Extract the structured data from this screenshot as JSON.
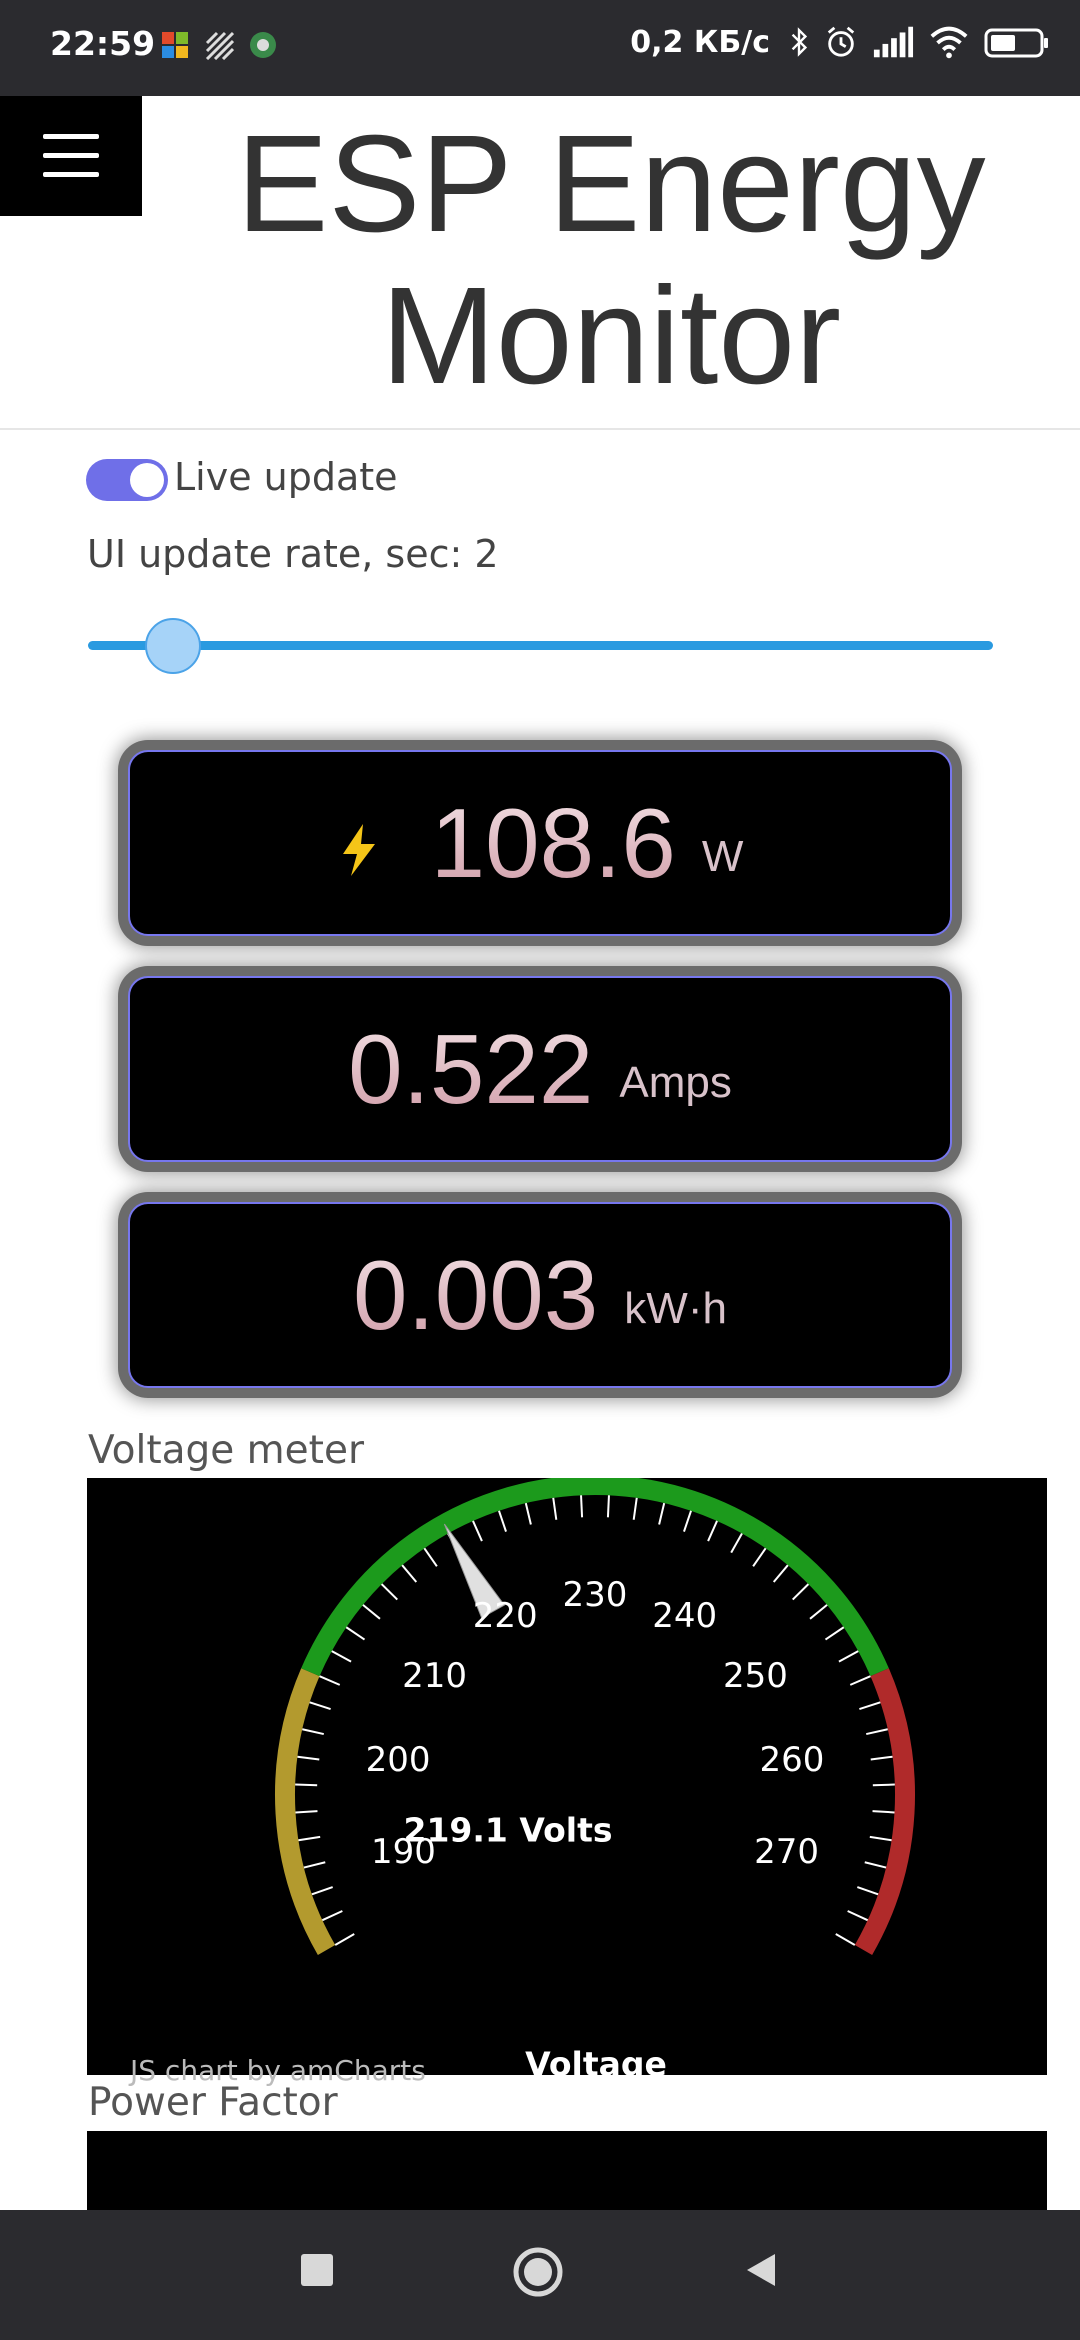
{
  "status_bar": {
    "time": "22:59",
    "speed": "0,2 КБ/с",
    "icons": [
      "office-app-icon",
      "pattern-app-icon",
      "browser-app-icon",
      "bluetooth-icon",
      "alarm-icon",
      "signal-icon",
      "wifi-icon",
      "battery-icon"
    ]
  },
  "header": {
    "title": "ESP Energy Monitor",
    "menu_icon": "hamburger-menu-icon"
  },
  "controls": {
    "live_update_label": "Live update",
    "live_update_on": true,
    "rate_label": "UI update rate, sec: 2",
    "rate_value": 2
  },
  "readouts": [
    {
      "icon": "lightning-bolt-icon",
      "value": "108.6",
      "unit": "W"
    },
    {
      "value": "0.522",
      "unit": "Amps"
    },
    {
      "value": "0.003",
      "unit": "kW·h"
    }
  ],
  "voltage": {
    "section_title": "Voltage meter",
    "reading": "219.1 Volts",
    "axis_label": "Voltage",
    "credit": "JS chart by amCharts",
    "chart_data": {
      "type": "gauge",
      "min": 185,
      "max": 275,
      "value": 219.1,
      "major_ticks": [
        190,
        200,
        210,
        220,
        230,
        240,
        250,
        260,
        270
      ],
      "bands": [
        {
          "from": 185,
          "to": 205,
          "color": "#b39a2e"
        },
        {
          "from": 205,
          "to": 255,
          "color": "#1c9a1c"
        },
        {
          "from": 255,
          "to": 275,
          "color": "#b02a2a"
        }
      ]
    }
  },
  "power_factor": {
    "section_title": "Power Factor"
  },
  "colors": {
    "accent": "#6f6fe8",
    "slider": "#2a9ae0",
    "bolt": "#f5c518"
  }
}
